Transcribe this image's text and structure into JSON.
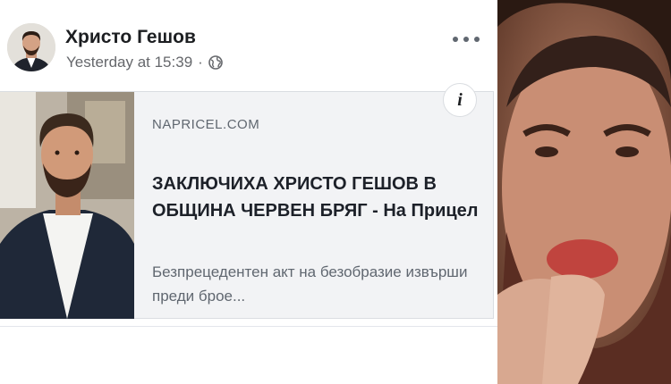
{
  "post": {
    "author_name": "Христо Гешов",
    "timestamp": "Yesterday at 15:39",
    "separator": "·",
    "privacy_icon": "globe-icon",
    "more_icon": "more-horizontal-icon"
  },
  "link_card": {
    "domain": "NAPRICEL.COM",
    "headline": "ЗАКЛЮЧИХА ХРИСТО ГЕШОВ В ОБЩИНА ЧЕРВЕН БРЯГ - На Прицел",
    "description": "Безпрецедентен акт на безобразие извърши преди брое...",
    "info_label": "i"
  },
  "colors": {
    "name": "#1c1e21",
    "meta": "#65676b",
    "card_background": "#f2f3f5",
    "card_border": "#dadde1"
  }
}
